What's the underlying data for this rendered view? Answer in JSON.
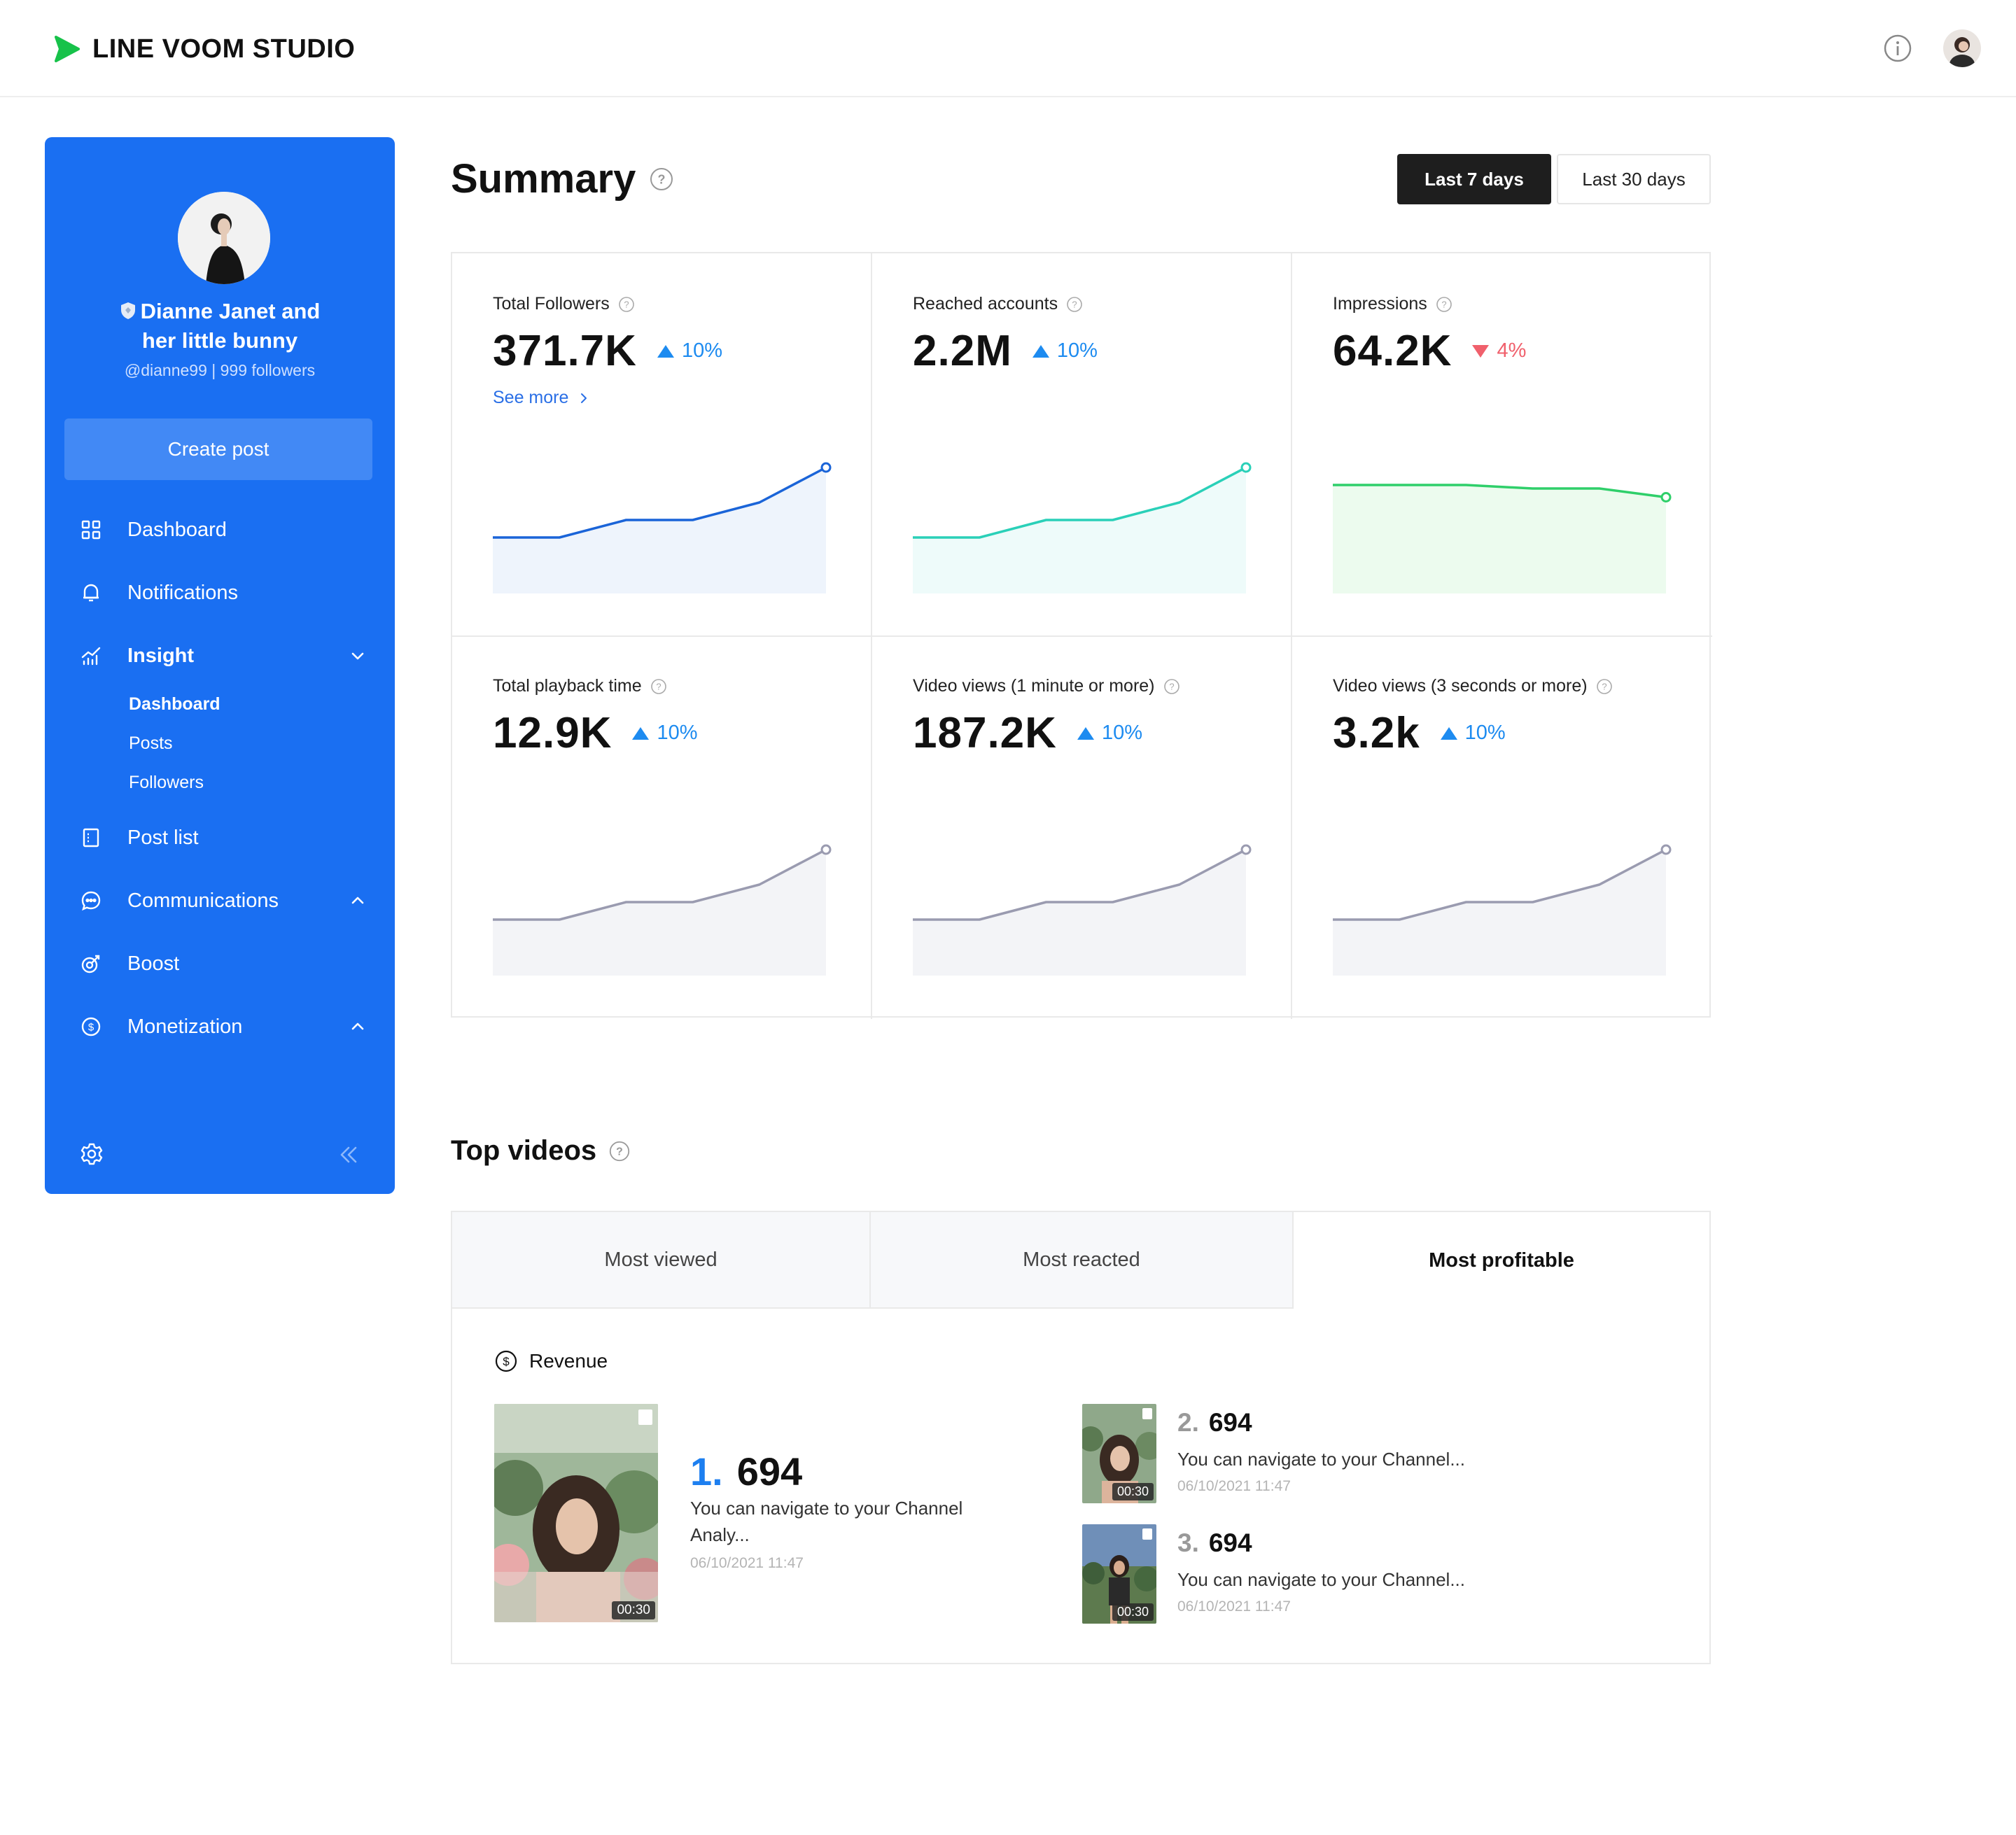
{
  "app": {
    "title": "LINE VOOM STUDIO"
  },
  "profile": {
    "name_line1": "Dianne Janet and",
    "name_line2": "her little bunny",
    "handle": "@dianne99 | 999 followers"
  },
  "sidebar": {
    "create_label": "Create post",
    "items": [
      {
        "label": "Dashboard",
        "icon": "grid-icon"
      },
      {
        "label": "Notifications",
        "icon": "bell-icon"
      },
      {
        "label": "Insight",
        "icon": "chart-icon"
      },
      {
        "label": "Post list",
        "icon": "document-icon"
      },
      {
        "label": "Communications",
        "icon": "chat-icon"
      },
      {
        "label": "Boost",
        "icon": "rocket-icon"
      },
      {
        "label": "Monetization",
        "icon": "dollar-icon"
      }
    ],
    "insight_sub": [
      "Dashboard",
      "Posts",
      "Followers"
    ]
  },
  "summary": {
    "title": "Summary",
    "range_active": "Last 7 days",
    "range_inactive": "Last 30 days",
    "see_more": "See more",
    "cards": [
      {
        "label": "Total Followers",
        "value": "371.7K",
        "delta": "10%",
        "trend": "up",
        "series": [
          2,
          2,
          3,
          3,
          4,
          6
        ],
        "color": "#1a64d8",
        "fill": "#eef4fc"
      },
      {
        "label": "Reached accounts",
        "value": "2.2M",
        "delta": "10%",
        "trend": "up",
        "series": [
          2,
          2,
          3,
          3,
          4,
          6
        ],
        "color": "#2ad0b8",
        "fill": "#eefbfa"
      },
      {
        "label": "Impressions",
        "value": "64.2K",
        "delta": "4%",
        "trend": "down",
        "series": [
          5,
          5,
          5,
          4.8,
          4.8,
          4.3
        ],
        "color": "#2fcf6a",
        "fill": "#ecfbee"
      },
      {
        "label": "Total playback time",
        "value": "12.9K",
        "delta": "10%",
        "trend": "up",
        "series": [
          2,
          2,
          3,
          3,
          4,
          6
        ],
        "color": "#9a9bb0",
        "fill": "#f3f4f7"
      },
      {
        "label": "Video views (1 minute or more)",
        "value": "187.2K",
        "delta": "10%",
        "trend": "up",
        "series": [
          2,
          2,
          3,
          3,
          4,
          6
        ],
        "color": "#9a9bb0",
        "fill": "#f3f4f7"
      },
      {
        "label": "Video views (3 seconds or more)",
        "value": "3.2k",
        "delta": "10%",
        "trend": "up",
        "series": [
          2,
          2,
          3,
          3,
          4,
          6
        ],
        "color": "#9a9bb0",
        "fill": "#f3f4f7"
      }
    ]
  },
  "top_videos": {
    "title": "Top videos",
    "tabs": [
      "Most viewed",
      "Most reacted",
      "Most profitable"
    ],
    "active_tab": "Most profitable",
    "revenue_label": "Revenue",
    "items": [
      {
        "rank": "1.",
        "value": "694",
        "desc_line1": "You can navigate to your Channel",
        "desc_line2": "Analy...",
        "date": "06/10/2021 11:47",
        "duration": "00:30"
      },
      {
        "rank": "2.",
        "value": "694",
        "desc": "You can navigate to your Channel...",
        "date": "06/10/2021 11:47",
        "duration": "00:30"
      },
      {
        "rank": "3.",
        "value": "694",
        "desc": "You can navigate to your Channel...",
        "date": "06/10/2021 11:47",
        "duration": "00:30"
      }
    ]
  }
}
